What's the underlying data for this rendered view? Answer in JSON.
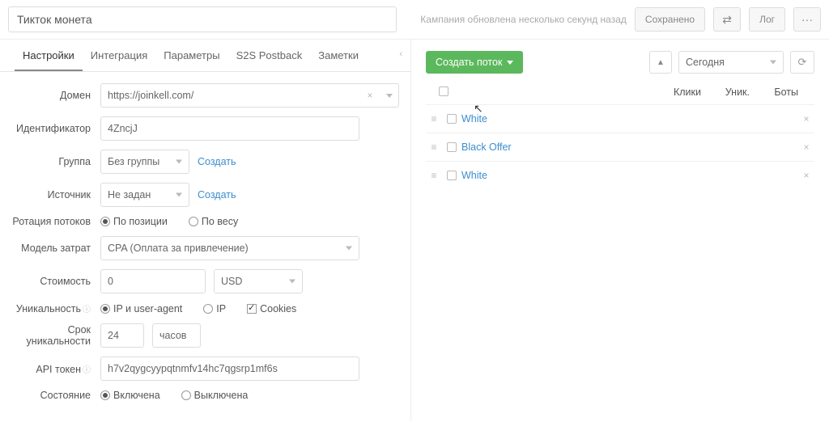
{
  "header": {
    "title": "Тикток монета",
    "updated_text": "Кампания обновлена несколько секунд назад",
    "saved_label": "Сохранено",
    "log_label": "Лог",
    "link_icon": "⇄",
    "more_icon": "···"
  },
  "tabs": [
    "Настройки",
    "Интеграция",
    "Параметры",
    "S2S Postback",
    "Заметки"
  ],
  "active_tab": 0,
  "form": {
    "domain_label": "Домен",
    "domain_value": "https://joinkell.com/",
    "id_label": "Идентификатор",
    "id_value": "4ZncjJ",
    "group_label": "Группа",
    "group_value": "Без группы",
    "group_create": "Создать",
    "source_label": "Источник",
    "source_value": "Не задан",
    "source_create": "Создать",
    "rotation_label": "Ротация потоков",
    "rotation_pos": "По позиции",
    "rotation_weight": "По весу",
    "cost_model_label": "Модель затрат",
    "cost_model_value": "CPA (Оплата за привлечение)",
    "cost_label": "Стоимость",
    "cost_value": "0",
    "currency": "USD",
    "uniq_label": "Уникальность",
    "uniq_ip_ua": "IP и user-agent",
    "uniq_ip": "IP",
    "uniq_cookies": "Cookies",
    "uniq_ttl_label": "Срок уникальности",
    "uniq_ttl_value": "24",
    "uniq_ttl_unit": "часов",
    "api_label": "API токен",
    "api_value": "h7v2qygcyypqtnmfv14hc7qgsrp1mf6s",
    "state_label": "Состояние",
    "state_on": "Включена",
    "state_off": "Выключена"
  },
  "right": {
    "create_flow": "Создать поток",
    "date_range": "Сегодня",
    "columns": {
      "clicks": "Клики",
      "unique": "Уник.",
      "bots": "Боты"
    },
    "flows": [
      {
        "name": "White"
      },
      {
        "name": "Black Offer"
      },
      {
        "name": "White"
      }
    ]
  }
}
